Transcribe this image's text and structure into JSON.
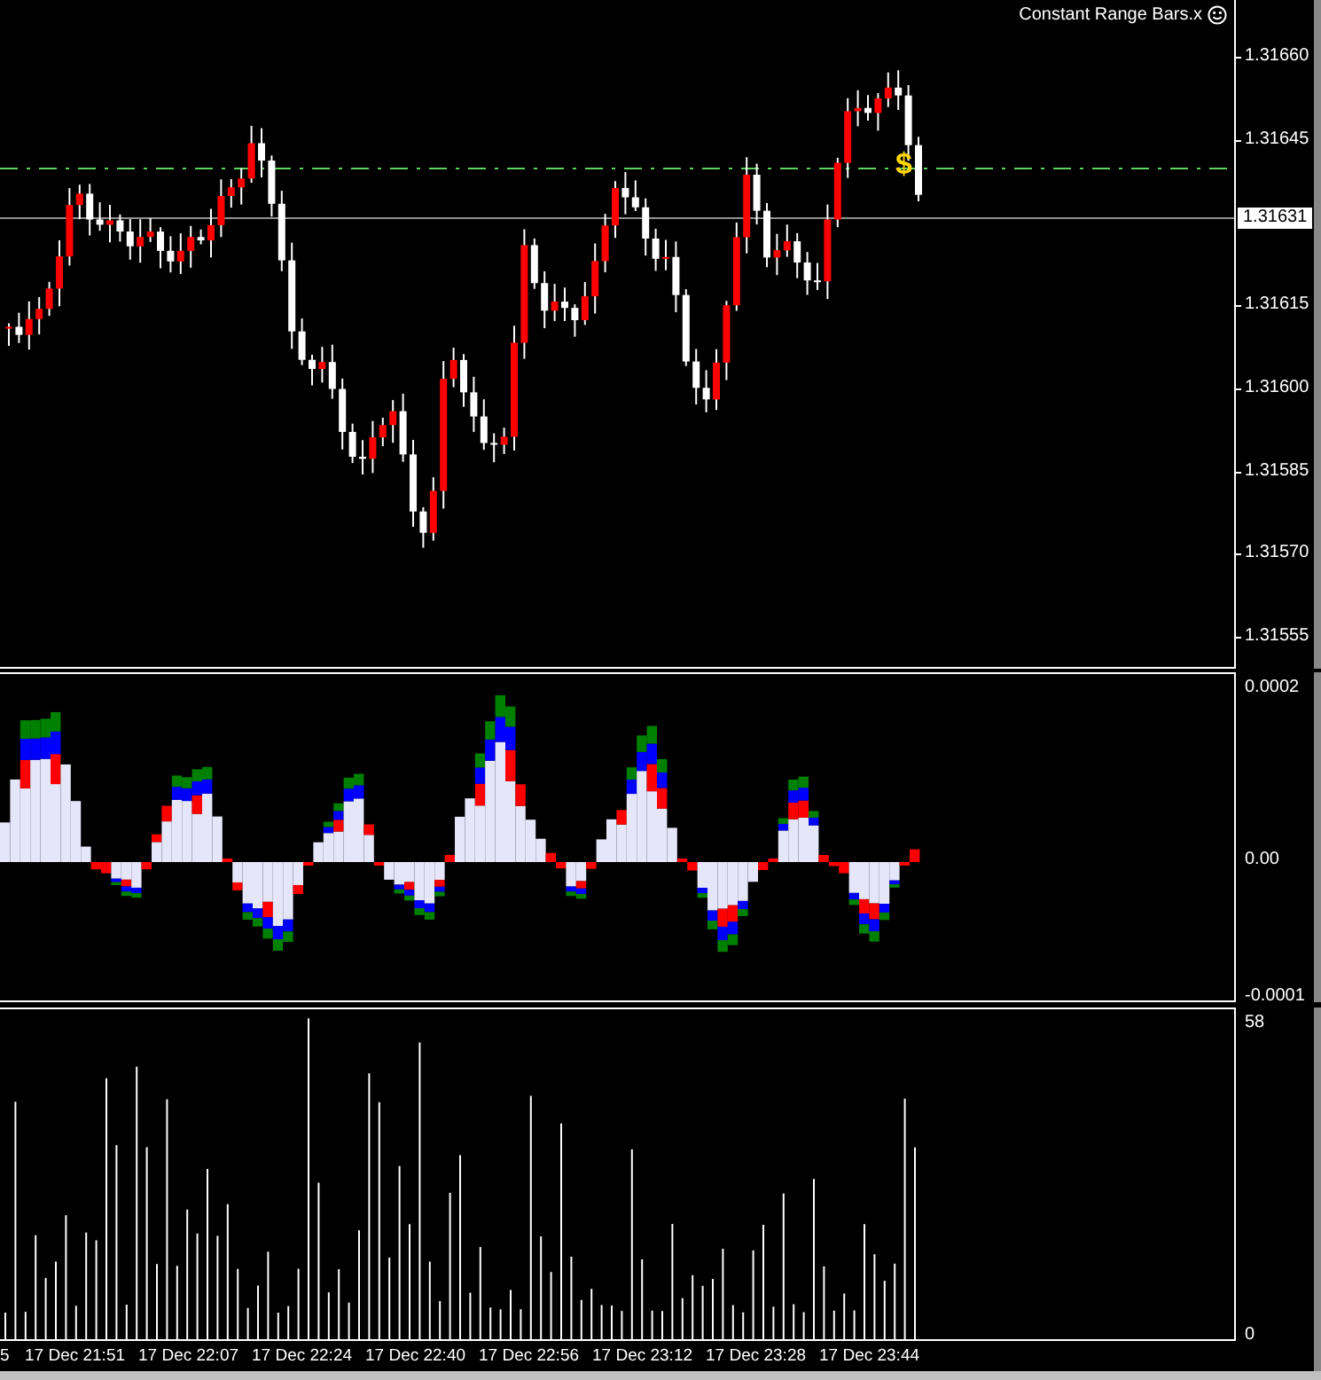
{
  "chart": {
    "indicator_title": "Constant Range Bars.x",
    "signal_label": "$",
    "current_price": "1.31631",
    "price_axis": [
      "1.31660",
      "1.31645",
      "1.31615",
      "1.31600",
      "1.31585",
      "1.31570",
      "1.31555"
    ]
  },
  "oscillator": {
    "axis": [
      "0.0002",
      "0.00",
      "-0.0001"
    ]
  },
  "volume": {
    "axis": [
      "58",
      "0"
    ]
  },
  "time_axis": [
    "5",
    "17 Dec 21:51",
    "17 Dec 22:07",
    "17 Dec 22:24",
    "17 Dec 22:40",
    "17 Dec 22:56",
    "17 Dec 23:12",
    "17 Dec 23:28",
    "17 Dec 23:44"
  ]
}
